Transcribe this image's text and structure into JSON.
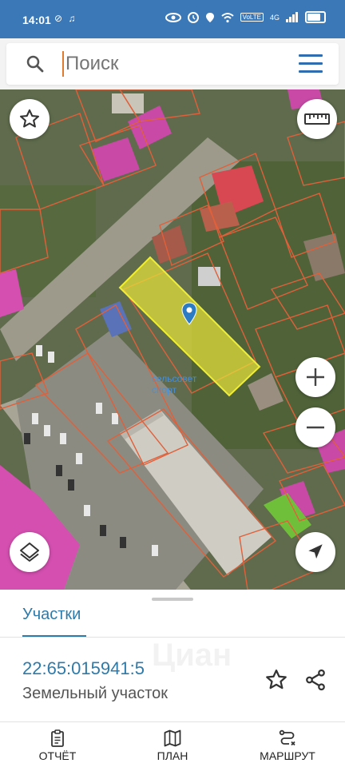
{
  "status_bar": {
    "time": "14:01",
    "left_icons": "⊘ ♫",
    "signal": "4G",
    "volte": "VoLTE"
  },
  "search": {
    "placeholder": "Поиск",
    "value": ""
  },
  "map": {
    "overlay_label_line1": "сельсовет",
    "overlay_label_line2": "спорт",
    "selected_fill": "#e6e23a",
    "parcel_stroke": "#e0603a",
    "marker_color": "#2b7bc4"
  },
  "sheet": {
    "tab_label": "Участки",
    "cadastral_number": "22:65:015941:5",
    "parcel_type": "Земельный участок",
    "watermark": "Циан"
  },
  "nav": {
    "report_label": "ОТЧЁТ",
    "plan_label": "ПЛАН",
    "route_label": "МАРШРУТ"
  },
  "colors": {
    "accent": "#2f7aa8",
    "status_bar": "#3b78b8",
    "menu": "#2f6db0"
  }
}
